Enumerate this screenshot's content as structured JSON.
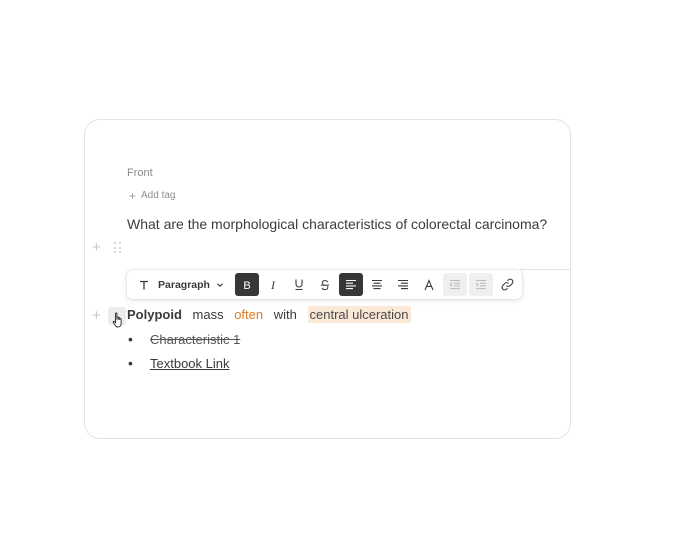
{
  "card": {
    "side_label": "Front",
    "add_tag_label": "Add tag",
    "question": "What are the morphological characteristics of colorectal carcinoma?"
  },
  "toolbar": {
    "block_type": "Paragraph",
    "buttons": [
      "text-type",
      "bold",
      "italic",
      "underline",
      "strikethrough",
      "align-left",
      "align-center",
      "align-right",
      "text-color",
      "indent-decrease",
      "indent-increase",
      "link"
    ]
  },
  "answer": {
    "words": [
      {
        "text": "Polypoid",
        "style": "bold"
      },
      {
        "text": "mass",
        "style": "plain"
      },
      {
        "text": "often",
        "style": "orange"
      },
      {
        "text": "with",
        "style": "plain"
      },
      {
        "text": "central  ulceration",
        "style": "highlight"
      }
    ],
    "bullets": [
      {
        "text": "Characteristic 1",
        "style": "strikethrough"
      },
      {
        "text": "Textbook Link",
        "style": "link"
      }
    ]
  },
  "colors": {
    "accent_orange": "#e07a1f",
    "highlight": "#fbe9d7",
    "active_button": "#373737"
  }
}
